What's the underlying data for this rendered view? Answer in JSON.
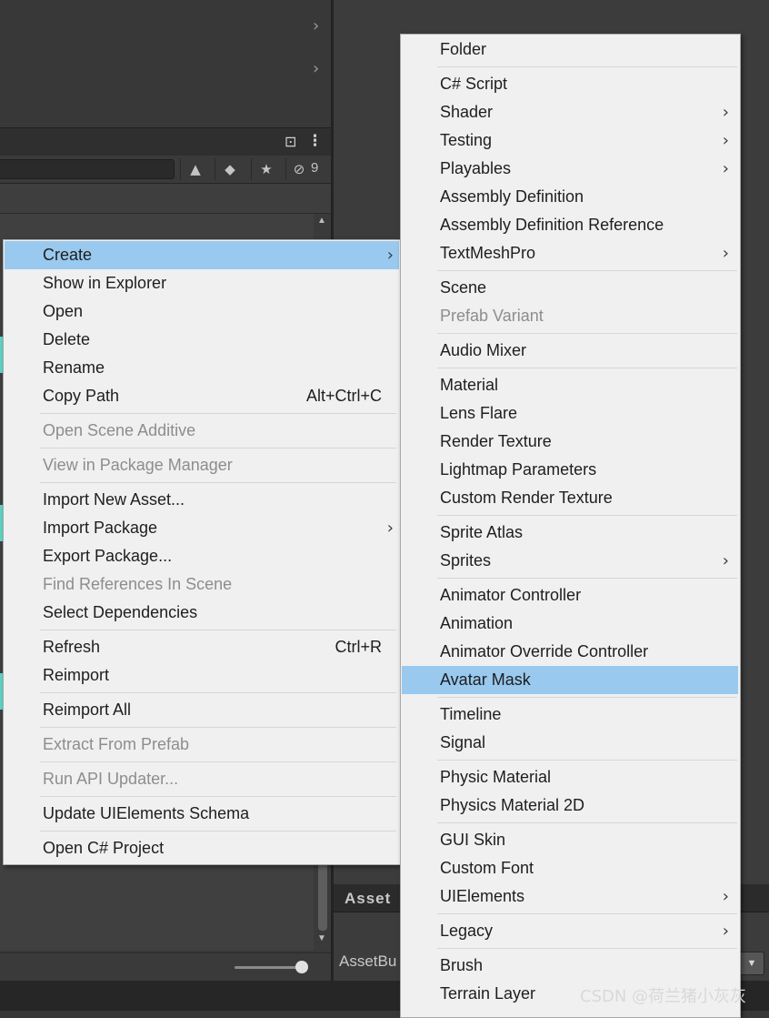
{
  "project_panel": {
    "hidden_count": "9",
    "asset_tab": "Asset",
    "assetbundle_label": "AssetBu"
  },
  "left_menu": [
    {
      "label": "Create",
      "submenu": true,
      "highlight": true,
      "name": "menu-item-create"
    },
    {
      "label": "Show in Explorer",
      "name": "menu-item-show-in-explorer"
    },
    {
      "label": "Open",
      "name": "menu-item-open"
    },
    {
      "label": "Delete",
      "name": "menu-item-delete"
    },
    {
      "label": "Rename",
      "name": "menu-item-rename"
    },
    {
      "label": "Copy Path",
      "shortcut": "Alt+Ctrl+C",
      "name": "menu-item-copy-path"
    },
    {
      "separator": true
    },
    {
      "label": "Open Scene Additive",
      "disabled": true,
      "name": "menu-item-open-scene-additive"
    },
    {
      "separator": true
    },
    {
      "label": "View in Package Manager",
      "disabled": true,
      "name": "menu-item-view-in-package-manager"
    },
    {
      "separator": true
    },
    {
      "label": "Import New Asset...",
      "name": "menu-item-import-new-asset"
    },
    {
      "label": "Import Package",
      "submenu": true,
      "name": "menu-item-import-package"
    },
    {
      "label": "Export Package...",
      "name": "menu-item-export-package"
    },
    {
      "label": "Find References In Scene",
      "disabled": true,
      "name": "menu-item-find-references-in-scene"
    },
    {
      "label": "Select Dependencies",
      "name": "menu-item-select-dependencies"
    },
    {
      "separator": true
    },
    {
      "label": "Refresh",
      "shortcut": "Ctrl+R",
      "name": "menu-item-refresh"
    },
    {
      "label": "Reimport",
      "name": "menu-item-reimport"
    },
    {
      "separator": true
    },
    {
      "label": "Reimport All",
      "name": "menu-item-reimport-all"
    },
    {
      "separator": true
    },
    {
      "label": "Extract From Prefab",
      "disabled": true,
      "name": "menu-item-extract-from-prefab"
    },
    {
      "separator": true
    },
    {
      "label": "Run API Updater...",
      "disabled": true,
      "name": "menu-item-run-api-updater"
    },
    {
      "separator": true
    },
    {
      "label": "Update UIElements Schema",
      "name": "menu-item-update-uielements-schema"
    },
    {
      "separator": true
    },
    {
      "label": "Open C# Project",
      "name": "menu-item-open-csharp-project"
    }
  ],
  "right_menu": [
    {
      "label": "Folder",
      "name": "menu-item-folder"
    },
    {
      "separator": true
    },
    {
      "label": "C# Script",
      "name": "menu-item-csharp-script"
    },
    {
      "label": "Shader",
      "submenu": true,
      "name": "menu-item-shader"
    },
    {
      "label": "Testing",
      "submenu": true,
      "name": "menu-item-testing"
    },
    {
      "label": "Playables",
      "submenu": true,
      "name": "menu-item-playables"
    },
    {
      "label": "Assembly Definition",
      "name": "menu-item-assembly-definition"
    },
    {
      "label": "Assembly Definition Reference",
      "name": "menu-item-assembly-definition-reference"
    },
    {
      "label": "TextMeshPro",
      "submenu": true,
      "name": "menu-item-textmeshpro"
    },
    {
      "separator": true
    },
    {
      "label": "Scene",
      "name": "menu-item-scene"
    },
    {
      "label": "Prefab Variant",
      "disabled": true,
      "name": "menu-item-prefab-variant"
    },
    {
      "separator": true
    },
    {
      "label": "Audio Mixer",
      "name": "menu-item-audio-mixer"
    },
    {
      "separator": true
    },
    {
      "label": "Material",
      "name": "menu-item-material"
    },
    {
      "label": "Lens Flare",
      "name": "menu-item-lens-flare"
    },
    {
      "label": "Render Texture",
      "name": "menu-item-render-texture"
    },
    {
      "label": "Lightmap Parameters",
      "name": "menu-item-lightmap-parameters"
    },
    {
      "label": "Custom Render Texture",
      "name": "menu-item-custom-render-texture"
    },
    {
      "separator": true
    },
    {
      "label": "Sprite Atlas",
      "name": "menu-item-sprite-atlas"
    },
    {
      "label": "Sprites",
      "submenu": true,
      "name": "menu-item-sprites"
    },
    {
      "separator": true
    },
    {
      "label": "Animator Controller",
      "name": "menu-item-animator-controller"
    },
    {
      "label": "Animation",
      "name": "menu-item-animation"
    },
    {
      "label": "Animator Override Controller",
      "name": "menu-item-animator-override-controller"
    },
    {
      "label": "Avatar Mask",
      "highlight": true,
      "name": "menu-item-avatar-mask"
    },
    {
      "separator": true
    },
    {
      "label": "Timeline",
      "name": "menu-item-timeline"
    },
    {
      "label": "Signal",
      "name": "menu-item-signal"
    },
    {
      "separator": true
    },
    {
      "label": "Physic Material",
      "name": "menu-item-physic-material"
    },
    {
      "label": "Physics Material 2D",
      "name": "menu-item-physics-material-2d"
    },
    {
      "separator": true
    },
    {
      "label": "GUI Skin",
      "name": "menu-item-gui-skin"
    },
    {
      "label": "Custom Font",
      "name": "menu-item-custom-font"
    },
    {
      "label": "UIElements",
      "submenu": true,
      "name": "menu-item-uielements"
    },
    {
      "separator": true
    },
    {
      "label": "Legacy",
      "submenu": true,
      "name": "menu-item-legacy"
    },
    {
      "separator": true
    },
    {
      "label": "Brush",
      "name": "menu-item-brush"
    },
    {
      "label": "Terrain Layer",
      "name": "menu-item-terrain-layer"
    }
  ],
  "watermark": "CSDN @荷兰猪小灰灰",
  "colors": {
    "menu_bg": "#f0f0f0",
    "highlight": "#99c9ef",
    "disabled_text": "#8d8d8d",
    "editor_bg": "#383838"
  }
}
